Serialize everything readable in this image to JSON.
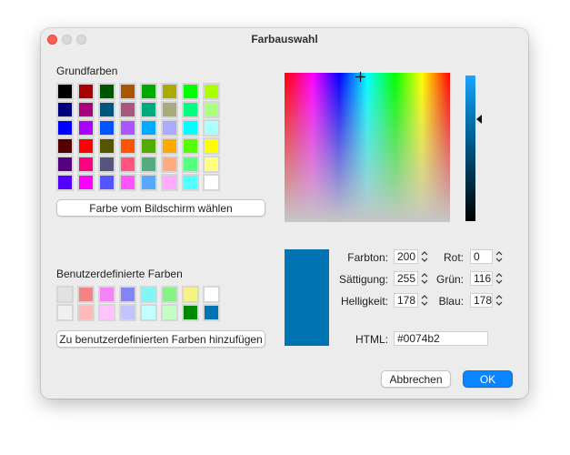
{
  "window": {
    "title": "Farbauswahl"
  },
  "basic": {
    "title": "Grundfarben",
    "swatches": [
      [
        "#000000",
        "#aa0000",
        "#005500",
        "#aa5500",
        "#00aa00",
        "#aaaa00",
        "#00ff00",
        "#aaff00"
      ],
      [
        "#00007f",
        "#aa007f",
        "#00557f",
        "#aa557f",
        "#00aa7f",
        "#aaaa7f",
        "#00ff7f",
        "#aaff7f"
      ],
      [
        "#0000ff",
        "#aa00ff",
        "#0055ff",
        "#aa55ff",
        "#00aaff",
        "#aaaaff",
        "#00ffff",
        "#aaffff"
      ],
      [
        "#550000",
        "#ff0000",
        "#555500",
        "#ff5500",
        "#55aa00",
        "#ffaa00",
        "#55ff00",
        "#ffff00"
      ],
      [
        "#55007f",
        "#ff007f",
        "#55557f",
        "#ff557f",
        "#55aa7f",
        "#ffaa7f",
        "#55ff7f",
        "#ffff7f"
      ],
      [
        "#5500ff",
        "#ff00ff",
        "#5555ff",
        "#ff55ff",
        "#55aaff",
        "#ffaaff",
        "#55ffff",
        "#ffffff"
      ]
    ],
    "pick_button": "Farbe vom Bildschirm wählen"
  },
  "custom": {
    "title": "Benutzerdefinierte Farben",
    "swatches": [
      [
        "#e2e2e2",
        "#f48484",
        "#f484f4",
        "#8484f4",
        "#84f4f4",
        "#84f484",
        "#f4f484",
        "#ffffff"
      ],
      [
        "#f0f0f0",
        "#ffb9b9",
        "#ffc3ff",
        "#c3c3ff",
        "#c3ffff",
        "#c3ffc3",
        "#008800",
        "#0074b2"
      ]
    ],
    "add_button": "Zu benutzerdefinierten Farben hinzufügen"
  },
  "current_color": "#0074b2",
  "fields": {
    "hue_label": "Farbton:",
    "hue": "200",
    "sat_label": "Sättigung:",
    "sat": "255",
    "val_label": "Helligkeit:",
    "val": "178",
    "red_label": "Rot:",
    "red": "0",
    "green_label": "Grün:",
    "green": "116",
    "blue_label": "Blau:",
    "blue": "178",
    "html_label": "HTML:",
    "html": "#0074b2"
  },
  "buttons": {
    "cancel": "Abbrechen",
    "ok": "OK"
  }
}
